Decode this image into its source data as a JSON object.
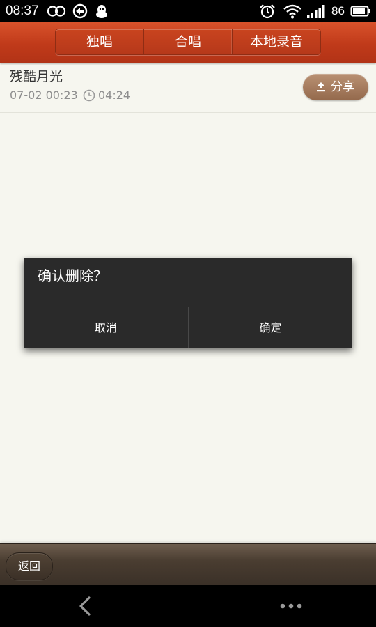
{
  "status_bar": {
    "time": "08:37",
    "battery_level": "86",
    "left_icons": [
      "infinity-icon",
      "sync-icon",
      "qq-penguin-icon"
    ],
    "right_icons": [
      "alarm-icon",
      "wifi-icon",
      "signal-icon",
      "battery-icon"
    ]
  },
  "header": {
    "tabs": [
      {
        "label": "独唱"
      },
      {
        "label": "合唱"
      },
      {
        "label": "本地录音"
      }
    ]
  },
  "recording": {
    "title": "残酷月光",
    "date": "07-02 00:23",
    "duration": "04:24",
    "share_label": "分享"
  },
  "dialog": {
    "message": "确认删除？",
    "cancel_label": "取消",
    "confirm_label": "确定"
  },
  "toolbar": {
    "back_label": "返回"
  },
  "colors": {
    "header_red": "#c03a1a",
    "share_brown": "#a57d5f",
    "dialog_bg": "#2a2a2a",
    "toolbar_brown": "#4a3d31",
    "page_bg": "#f6f6ef"
  }
}
